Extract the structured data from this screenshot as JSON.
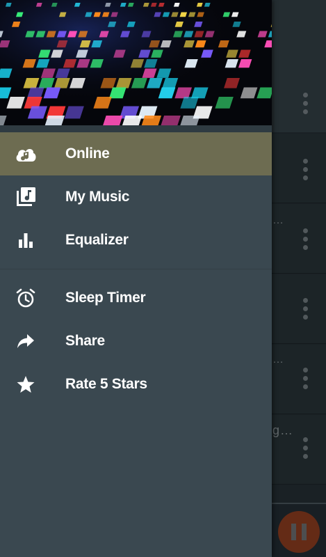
{
  "drawer": {
    "items": [
      {
        "label": "Online",
        "icon": "cloud-music-icon",
        "active": true
      },
      {
        "label": "My Music",
        "icon": "music-library-icon",
        "active": false
      },
      {
        "label": "Equalizer",
        "icon": "equalizer-icon",
        "active": false
      }
    ],
    "secondary_items": [
      {
        "label": "Sleep Timer",
        "icon": "alarm-clock-icon"
      },
      {
        "label": "Share",
        "icon": "share-arrow-icon"
      },
      {
        "label": "Rate 5 Stars",
        "icon": "star-icon"
      }
    ]
  },
  "background": {
    "ellipses": [
      "…",
      "…",
      "g…"
    ]
  },
  "colors": {
    "drawer_bg": "#3a4850",
    "active_item_bg": "#6d6c51",
    "text": "#ffffff",
    "fab": "#b84a22"
  }
}
